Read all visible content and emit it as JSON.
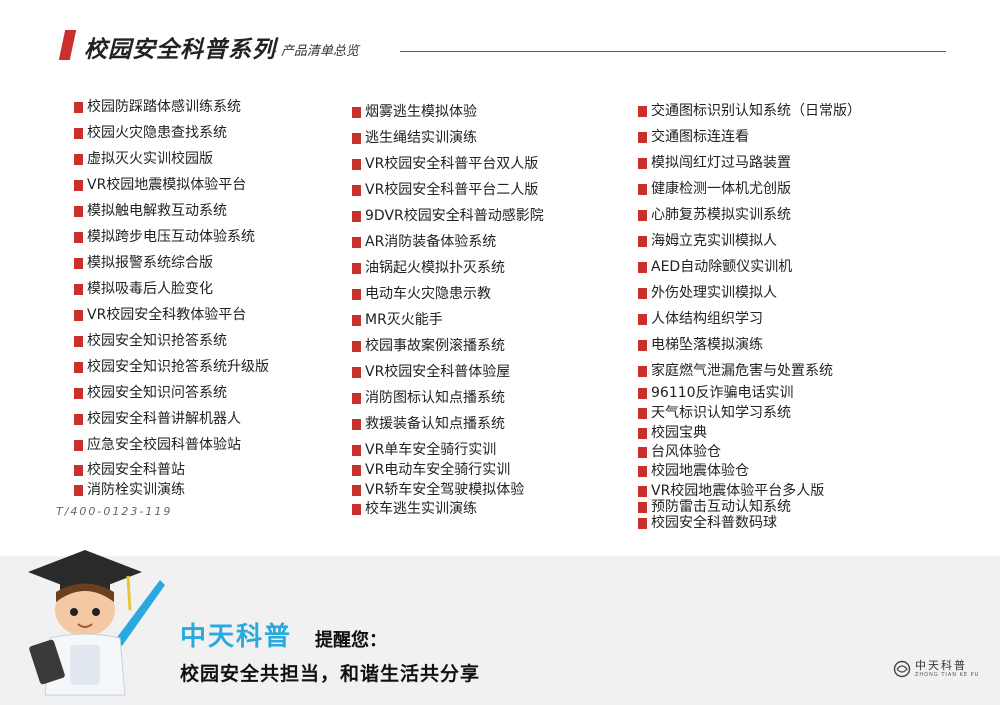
{
  "header": {
    "title": "校园安全科普系列",
    "subtitle": "- 产品清单总览"
  },
  "columns": [
    {
      "items": [
        "校园防踩踏体感训练系统",
        "校园火灾隐患查找系统",
        "虚拟灭火实训校园版",
        "VR校园地震模拟体验平台",
        "模拟触电解救互动系统",
        "模拟跨步电压互动体验系统",
        "模拟报警系统综合版",
        "模拟吸毒后人脸变化",
        "VR校园安全科教体验平台",
        "校园安全知识抢答系统",
        "校园安全知识抢答系统升级版",
        "校园安全知识问答系统",
        "校园安全科普讲解机器人",
        "应急安全校园科普体验站",
        "校园安全科普站",
        "消防栓实训演练"
      ]
    },
    {
      "items": [
        "烟雾逃生模拟体验",
        "逃生绳结实训演练",
        "VR校园安全科普平台双人版",
        "VR校园安全科普平台二人版",
        "9DVR校园安全科普动感影院",
        "AR消防装备体验系统",
        "油锅起火模拟扑灭系统",
        "电动车火灾隐患示教",
        "MR灭火能手",
        "校园事故案例滚播系统",
        "VR校园安全科普体验屋",
        "消防图标认知点播系统",
        "救援装备认知点播系统",
        "VR单车安全骑行实训",
        "VR电动车安全骑行实训",
        "VR轿车安全驾驶模拟体验",
        "校车逃生实训演练"
      ]
    },
    {
      "items": [
        "交通图标识别认知系统（日常版）",
        "交通图标连连看",
        "模拟闯红灯过马路装置",
        "健康检测一体机尤创版",
        "心肺复苏模拟实训系统",
        "海姆立克实训模拟人",
        "AED自动除颤仪实训机",
        "外伤处理实训模拟人",
        "人体结构组织学习",
        "电梯坠落模拟演练",
        "家庭燃气泄漏危害与处置系统",
        "96110反诈骗电话实训",
        "天气标识认知学习系统",
        "校园宝典",
        "台风体验仓",
        "校园地震体验仓",
        "VR校园地震体验平台多人版",
        "预防雷击互动认知系统",
        "校园安全科普数码球"
      ]
    }
  ],
  "phone": "T/400-0123-119",
  "footer": {
    "brand": "中天科普",
    "remind": "提醒您：",
    "slogan": "校园安全共担当，和谐生活共分享",
    "logo_cn": "中天科普",
    "logo_en": "ZHONG TIAN KE PU"
  },
  "colors": {
    "accent": "#c9302c",
    "brand_blue": "#29a9e0",
    "footer_bg": "#f1f1f1"
  },
  "icons": {
    "bullet": "red-square-bullet",
    "mascot": "doctor-mascot-with-book-and-pointer",
    "logo": "swirl-logo"
  }
}
